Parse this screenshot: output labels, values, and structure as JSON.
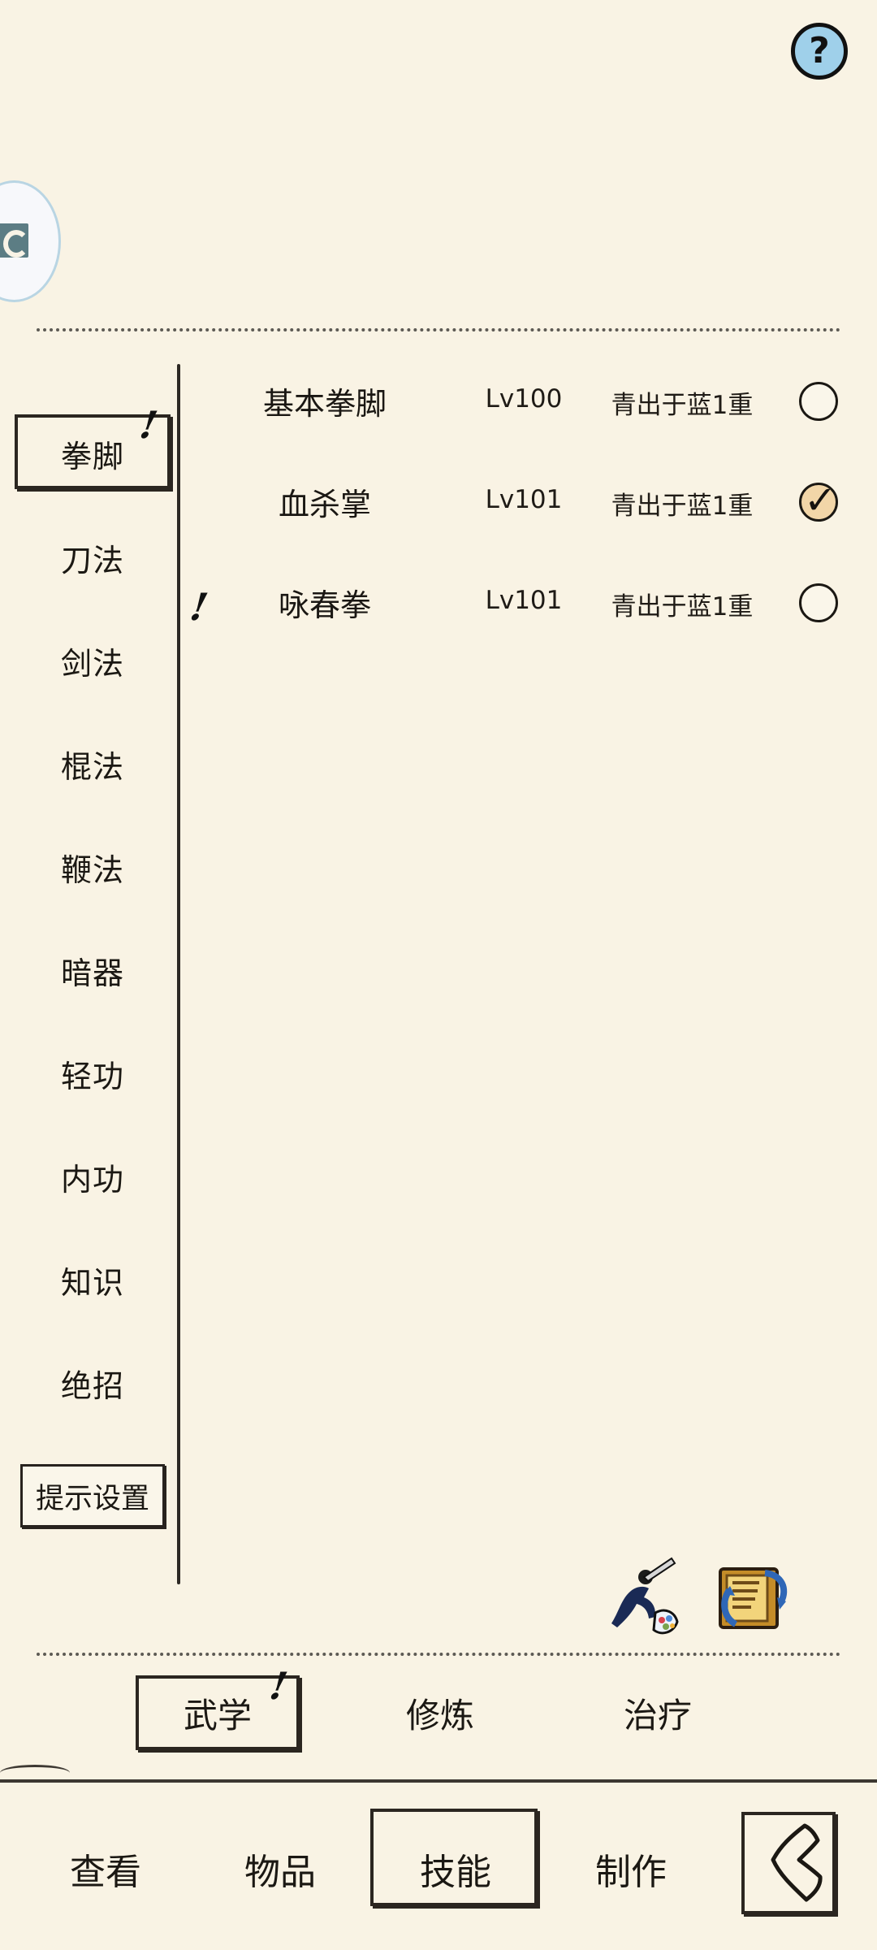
{
  "help": {
    "label": "?"
  },
  "categories": {
    "items": [
      {
        "label": "拳脚",
        "selected": true
      },
      {
        "label": "刀法"
      },
      {
        "label": "剑法"
      },
      {
        "label": "棍法"
      },
      {
        "label": "鞭法"
      },
      {
        "label": "暗器"
      },
      {
        "label": "轻功"
      },
      {
        "label": "内功"
      },
      {
        "label": "知识"
      },
      {
        "label": "绝招"
      }
    ],
    "settings_label": "提示设置",
    "exclaim_mark": "!"
  },
  "skills": [
    {
      "name": "基本拳脚",
      "level": "Lv100",
      "stage": "青出于蓝1重",
      "checked": false
    },
    {
      "name": "血杀掌",
      "level": "Lv101",
      "stage": "青出于蓝1重",
      "checked": true
    },
    {
      "name": "咏春拳",
      "level": "Lv101",
      "stage": "青出于蓝1重",
      "checked": false,
      "notice": "!"
    }
  ],
  "tools": {
    "icons": [
      "ninja-icon",
      "book-swap-icon"
    ]
  },
  "tabs": {
    "items": [
      {
        "label": "武学",
        "selected": true,
        "notice": "!"
      },
      {
        "label": "修炼"
      },
      {
        "label": "治疗"
      }
    ]
  },
  "bottom_nav": {
    "items": [
      {
        "label": "查看"
      },
      {
        "label": "物品"
      },
      {
        "label": "技能",
        "selected": true
      },
      {
        "label": "制作"
      }
    ],
    "back_icon": "back-arrow-icon"
  },
  "colors": {
    "background": "#f9f3e4",
    "ink": "#1b1813",
    "help_blue": "#9fd0ea",
    "check_fill": "#f2d6a8"
  }
}
